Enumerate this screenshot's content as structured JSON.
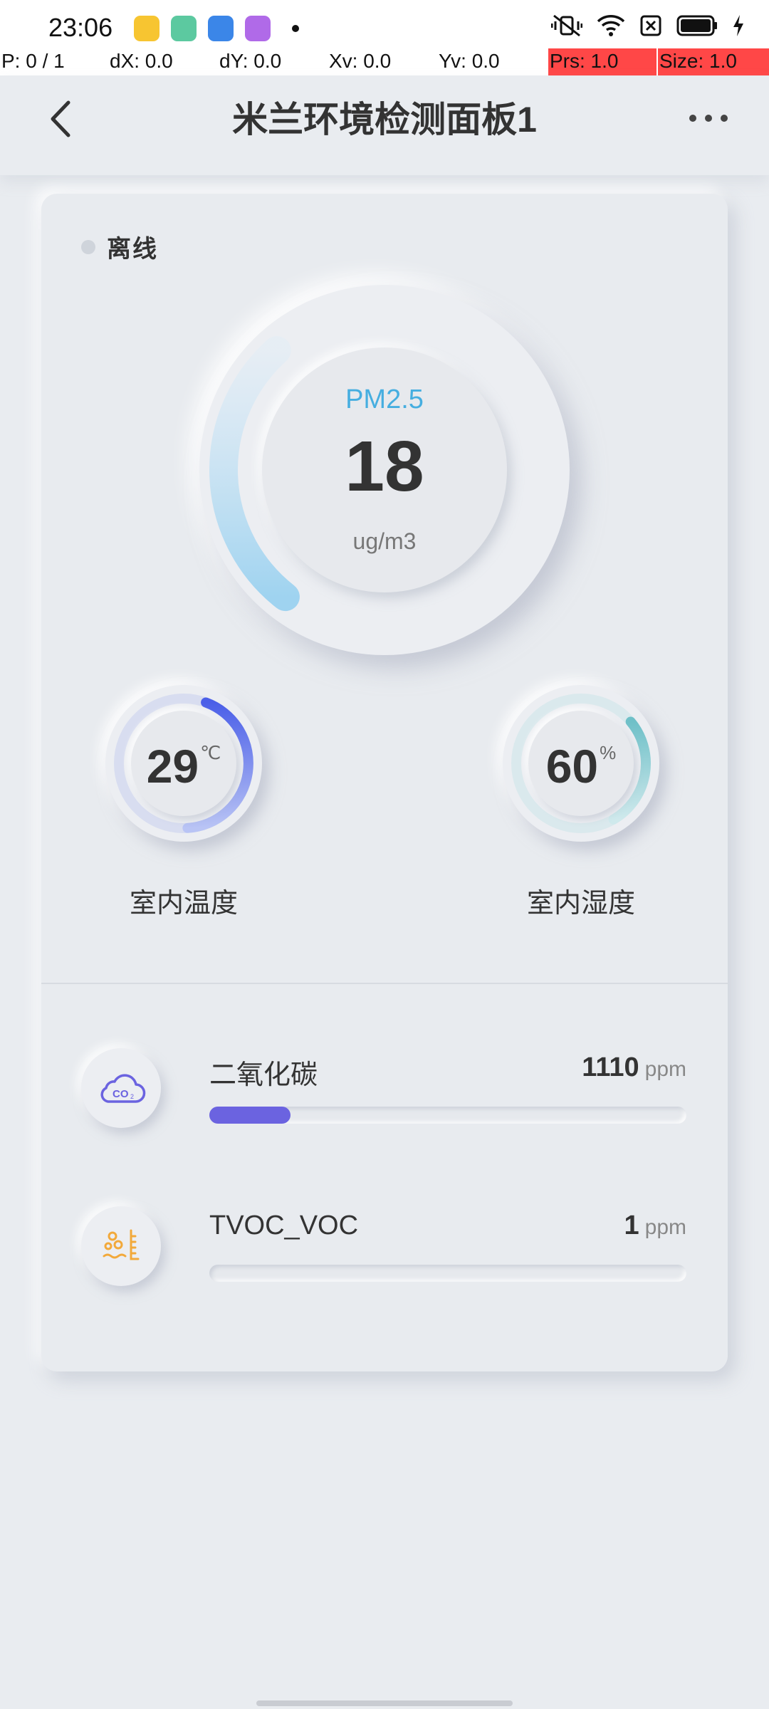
{
  "status_bar": {
    "time": "23:06",
    "notif_icons": [
      "files-icon",
      "photo-app-icon",
      "browser-icon",
      "store-icon"
    ],
    "right_icons": [
      "vibrate-icon",
      "wifi-icon",
      "no-sim-icon",
      "battery-icon",
      "charging-icon"
    ]
  },
  "debug": {
    "pointer": "P: 0 / 1",
    "dx": "dX: 0.0",
    "dy": "dY: 0.0",
    "xv": "Xv: 0.0",
    "yv": "Yv: 0.0",
    "prs": "Prs: 1.0",
    "size": "Size: 1.0"
  },
  "header": {
    "title": "米兰环境检测面板1",
    "back_icon": "chevron-left-icon",
    "more_icon": "more-horizontal-icon"
  },
  "device": {
    "status_label": "离线"
  },
  "pm25": {
    "label": "PM2.5",
    "value": "18",
    "unit": "ug/m3",
    "level": 0.18,
    "color": "#9fd3f0"
  },
  "temperature": {
    "value": "29",
    "unit": "℃",
    "caption": "室内温度",
    "level": 0.29,
    "color": "#5a6ff0"
  },
  "humidity": {
    "value": "60",
    "unit": "%",
    "caption": "室内湿度",
    "level": 0.2,
    "color": "#7fc6cf"
  },
  "metrics": [
    {
      "name": "二氧化碳",
      "value": "1110",
      "unit": "ppm",
      "icon": "co2-cloud-icon",
      "level": 0.17,
      "color": "#6b63e0"
    },
    {
      "name": "TVOC_VOC",
      "value": "1",
      "unit": "ppm",
      "icon": "voc-icon",
      "level": 0,
      "color": "#f2a93b"
    }
  ]
}
